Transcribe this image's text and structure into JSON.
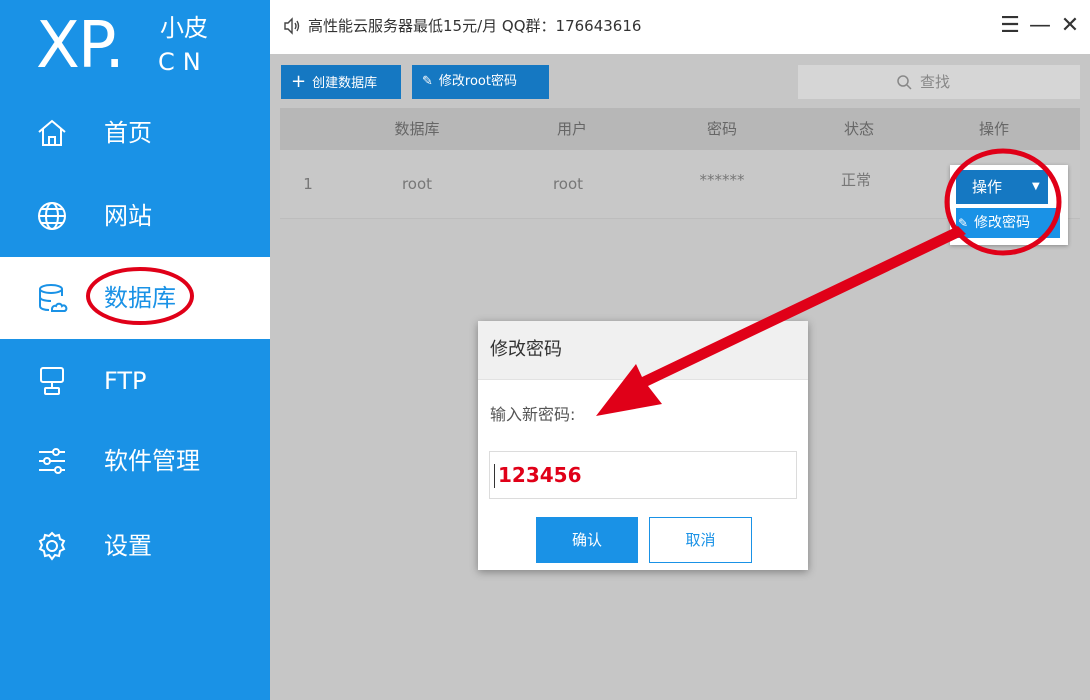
{
  "logo": {
    "main": "XP.",
    "sub": "小皮",
    "cn": "CN"
  },
  "nav": [
    {
      "label": "首页",
      "icon": "home-icon"
    },
    {
      "label": "网站",
      "icon": "globe-icon"
    },
    {
      "label": "数据库",
      "icon": "database-icon",
      "active": true
    },
    {
      "label": "FTP",
      "icon": "ftp-server-icon"
    },
    {
      "label": "软件管理",
      "icon": "sliders-icon"
    },
    {
      "label": "设置",
      "icon": "gear-icon"
    }
  ],
  "titlebar": {
    "text": "高性能云服务器最低15元/月 QQ群：176643616",
    "menu_glyph": "☰",
    "minimize_glyph": "—",
    "close_glyph": "✕"
  },
  "toolbar": {
    "create_db": "创建数据库",
    "change_root_pwd": "修改root密码",
    "search_placeholder": "查找"
  },
  "table": {
    "headers": [
      "数据库",
      "用户",
      "密码",
      "状态",
      "操作"
    ],
    "rows": [
      {
        "index": "1",
        "database": "root",
        "user": "root",
        "password": "******",
        "status": "正常"
      }
    ]
  },
  "dropdown": {
    "button": "操作",
    "item": "修改密码"
  },
  "dialog": {
    "title": "修改密码",
    "label": "输入新密码:",
    "value": "123456",
    "ok": "确认",
    "cancel": "取消"
  },
  "colors": {
    "sidebar": "#1a92e6",
    "primary_button": "#1578c2",
    "annotation": "#e00018"
  }
}
